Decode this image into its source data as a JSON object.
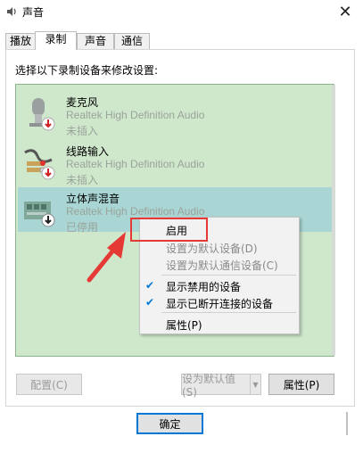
{
  "window": {
    "title": "声音",
    "close_glyph": "✕"
  },
  "tabs": [
    {
      "label": "播放",
      "active": false
    },
    {
      "label": "录制",
      "active": true
    },
    {
      "label": "声音",
      "active": false
    },
    {
      "label": "通信",
      "active": false
    }
  ],
  "instruction": "选择以下录制设备来修改设置:",
  "devices": [
    {
      "name": "麦克风",
      "description": "Realtek High Definition Audio",
      "status": "未插入",
      "icon": "microphone-icon",
      "badge": "disconnected-badge",
      "selected": false
    },
    {
      "name": "线路输入",
      "description": "Realtek High Definition Audio",
      "status": "未插入",
      "icon": "line-in-cable-icon",
      "badge": "disconnected-badge",
      "selected": false
    },
    {
      "name": "立体声混音",
      "description": "Realtek High Definition Audio",
      "status": "已停用",
      "icon": "sound-card-icon",
      "badge": "disabled-badge",
      "selected": true
    }
  ],
  "context_menu": {
    "items": [
      {
        "label": "启用",
        "enabled": true,
        "checked": false
      },
      {
        "label": "设置为默认设备(D)",
        "enabled": false,
        "checked": false
      },
      {
        "label": "设置为默认通信设备(C)",
        "enabled": false,
        "checked": false
      },
      {
        "label": "显示禁用的设备",
        "enabled": true,
        "checked": true
      },
      {
        "label": "显示已断开连接的设备",
        "enabled": true,
        "checked": true
      },
      {
        "label": "属性(P)",
        "enabled": true,
        "checked": false
      }
    ],
    "check_glyph": "✔"
  },
  "buttons": {
    "configure": "配置(C)",
    "set_default": "设为默认值(S)",
    "dropdown_glyph": "▼",
    "properties": "属性(P)",
    "ok": "确定"
  },
  "colors": {
    "list_bg": "#cfe8cc",
    "selected_bg": "#a9d6d4",
    "highlight": "#e53935",
    "accent": "#0078d7"
  }
}
